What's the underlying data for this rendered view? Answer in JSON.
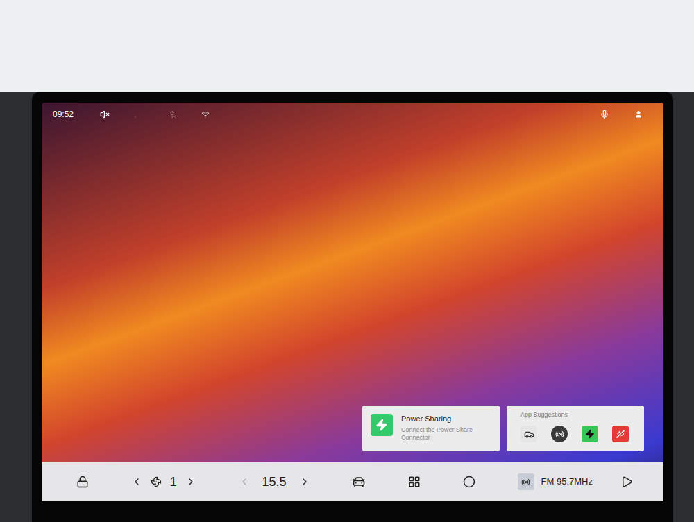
{
  "status_bar": {
    "time": "09:52",
    "muted": true,
    "cellular_connected": false,
    "bluetooth_on": false,
    "wifi_on": true
  },
  "power_card": {
    "title": "Power Sharing",
    "subtitle": "Connect the Power Share Connector"
  },
  "app_suggestions": {
    "title": "App Suggestions",
    "apps": [
      {
        "kind": "car",
        "color": "#e6e6e6"
      },
      {
        "kind": "radio",
        "color": "#3a3a3a"
      },
      {
        "kind": "power",
        "color": "#35c759"
      },
      {
        "kind": "usb",
        "color": "#e53935"
      }
    ]
  },
  "dock": {
    "fan_speed": "1",
    "temperature": "15.5",
    "radio": "FM 95.7MHz"
  }
}
